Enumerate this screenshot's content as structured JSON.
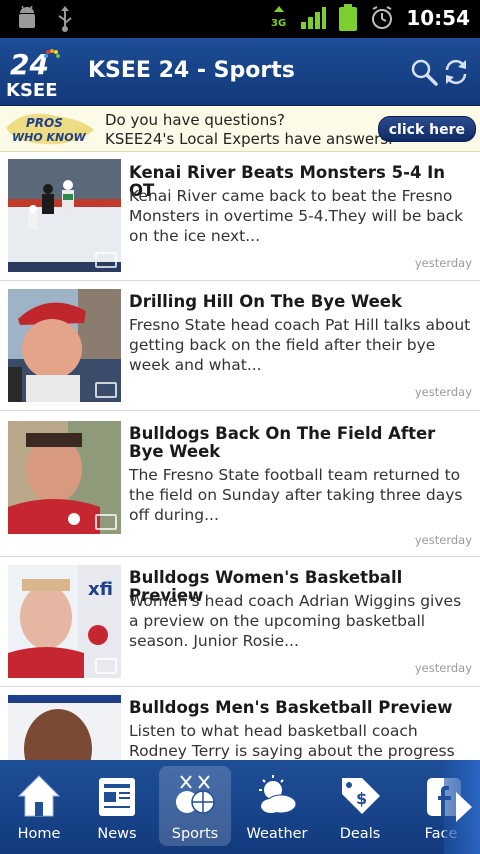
{
  "status_bar": {
    "time": "10:54",
    "icons": [
      "android-debug-icon",
      "usb-icon",
      "3g-icon",
      "signal-icon",
      "battery-icon",
      "alarm-icon"
    ]
  },
  "app_bar": {
    "logo_number": "24",
    "logo_text": "KSEE",
    "title": "KSEE 24 - Sports",
    "actions": [
      "search-icon",
      "refresh-icon"
    ]
  },
  "ad": {
    "logo_line1": "PROS",
    "logo_line2": "WHO KNOW",
    "line1": "Do you have questions?",
    "line2": "KSEE24's Local Experts have answers.",
    "button": "click here"
  },
  "articles": [
    {
      "title": "Kenai River Beats Monsters 5-4 In OT",
      "description": "Kenai River came back to beat the Fresno Monsters in overtime 5-4.They will be back on the ice next...",
      "time": "yesterday",
      "has_video": true
    },
    {
      "title": "Drilling Hill On The Bye Week",
      "description": "Fresno State head coach Pat Hill talks about getting back on the field after their bye week and what...",
      "time": "yesterday",
      "has_video": true
    },
    {
      "title": "Bulldogs Back On The Field After Bye Week",
      "description": "The Fresno State football team returned to the field on Sunday after taking three days off during...",
      "time": "yesterday",
      "has_video": true
    },
    {
      "title": "Bulldogs Women's Basketball Preview",
      "description": "Women's head coach Adrian Wiggins gives a preview on the upcoming basketball season. Junior Rosie...",
      "time": "yesterday",
      "has_video": true
    },
    {
      "title": "Bulldogs Men's Basketball Preview",
      "description": "Listen to what head basketball coach Rodney Terry is saying about the progress",
      "time": "",
      "has_video": false
    }
  ],
  "bottom_nav": {
    "items": [
      {
        "label": "Home",
        "icon": "home-icon",
        "active": false
      },
      {
        "label": "News",
        "icon": "news-icon",
        "active": false
      },
      {
        "label": "Sports",
        "icon": "sports-icon",
        "active": true
      },
      {
        "label": "Weather",
        "icon": "weather-icon",
        "active": false
      },
      {
        "label": "Deals",
        "icon": "deals-icon",
        "active": false
      },
      {
        "label": "Face",
        "icon": "facebook-icon",
        "active": false
      }
    ],
    "more_icon": "chevron-right-icon"
  },
  "colors": {
    "brand_blue": "#1d4d95",
    "status_bar": "#000000",
    "ad_background": "#fdfbe7"
  }
}
